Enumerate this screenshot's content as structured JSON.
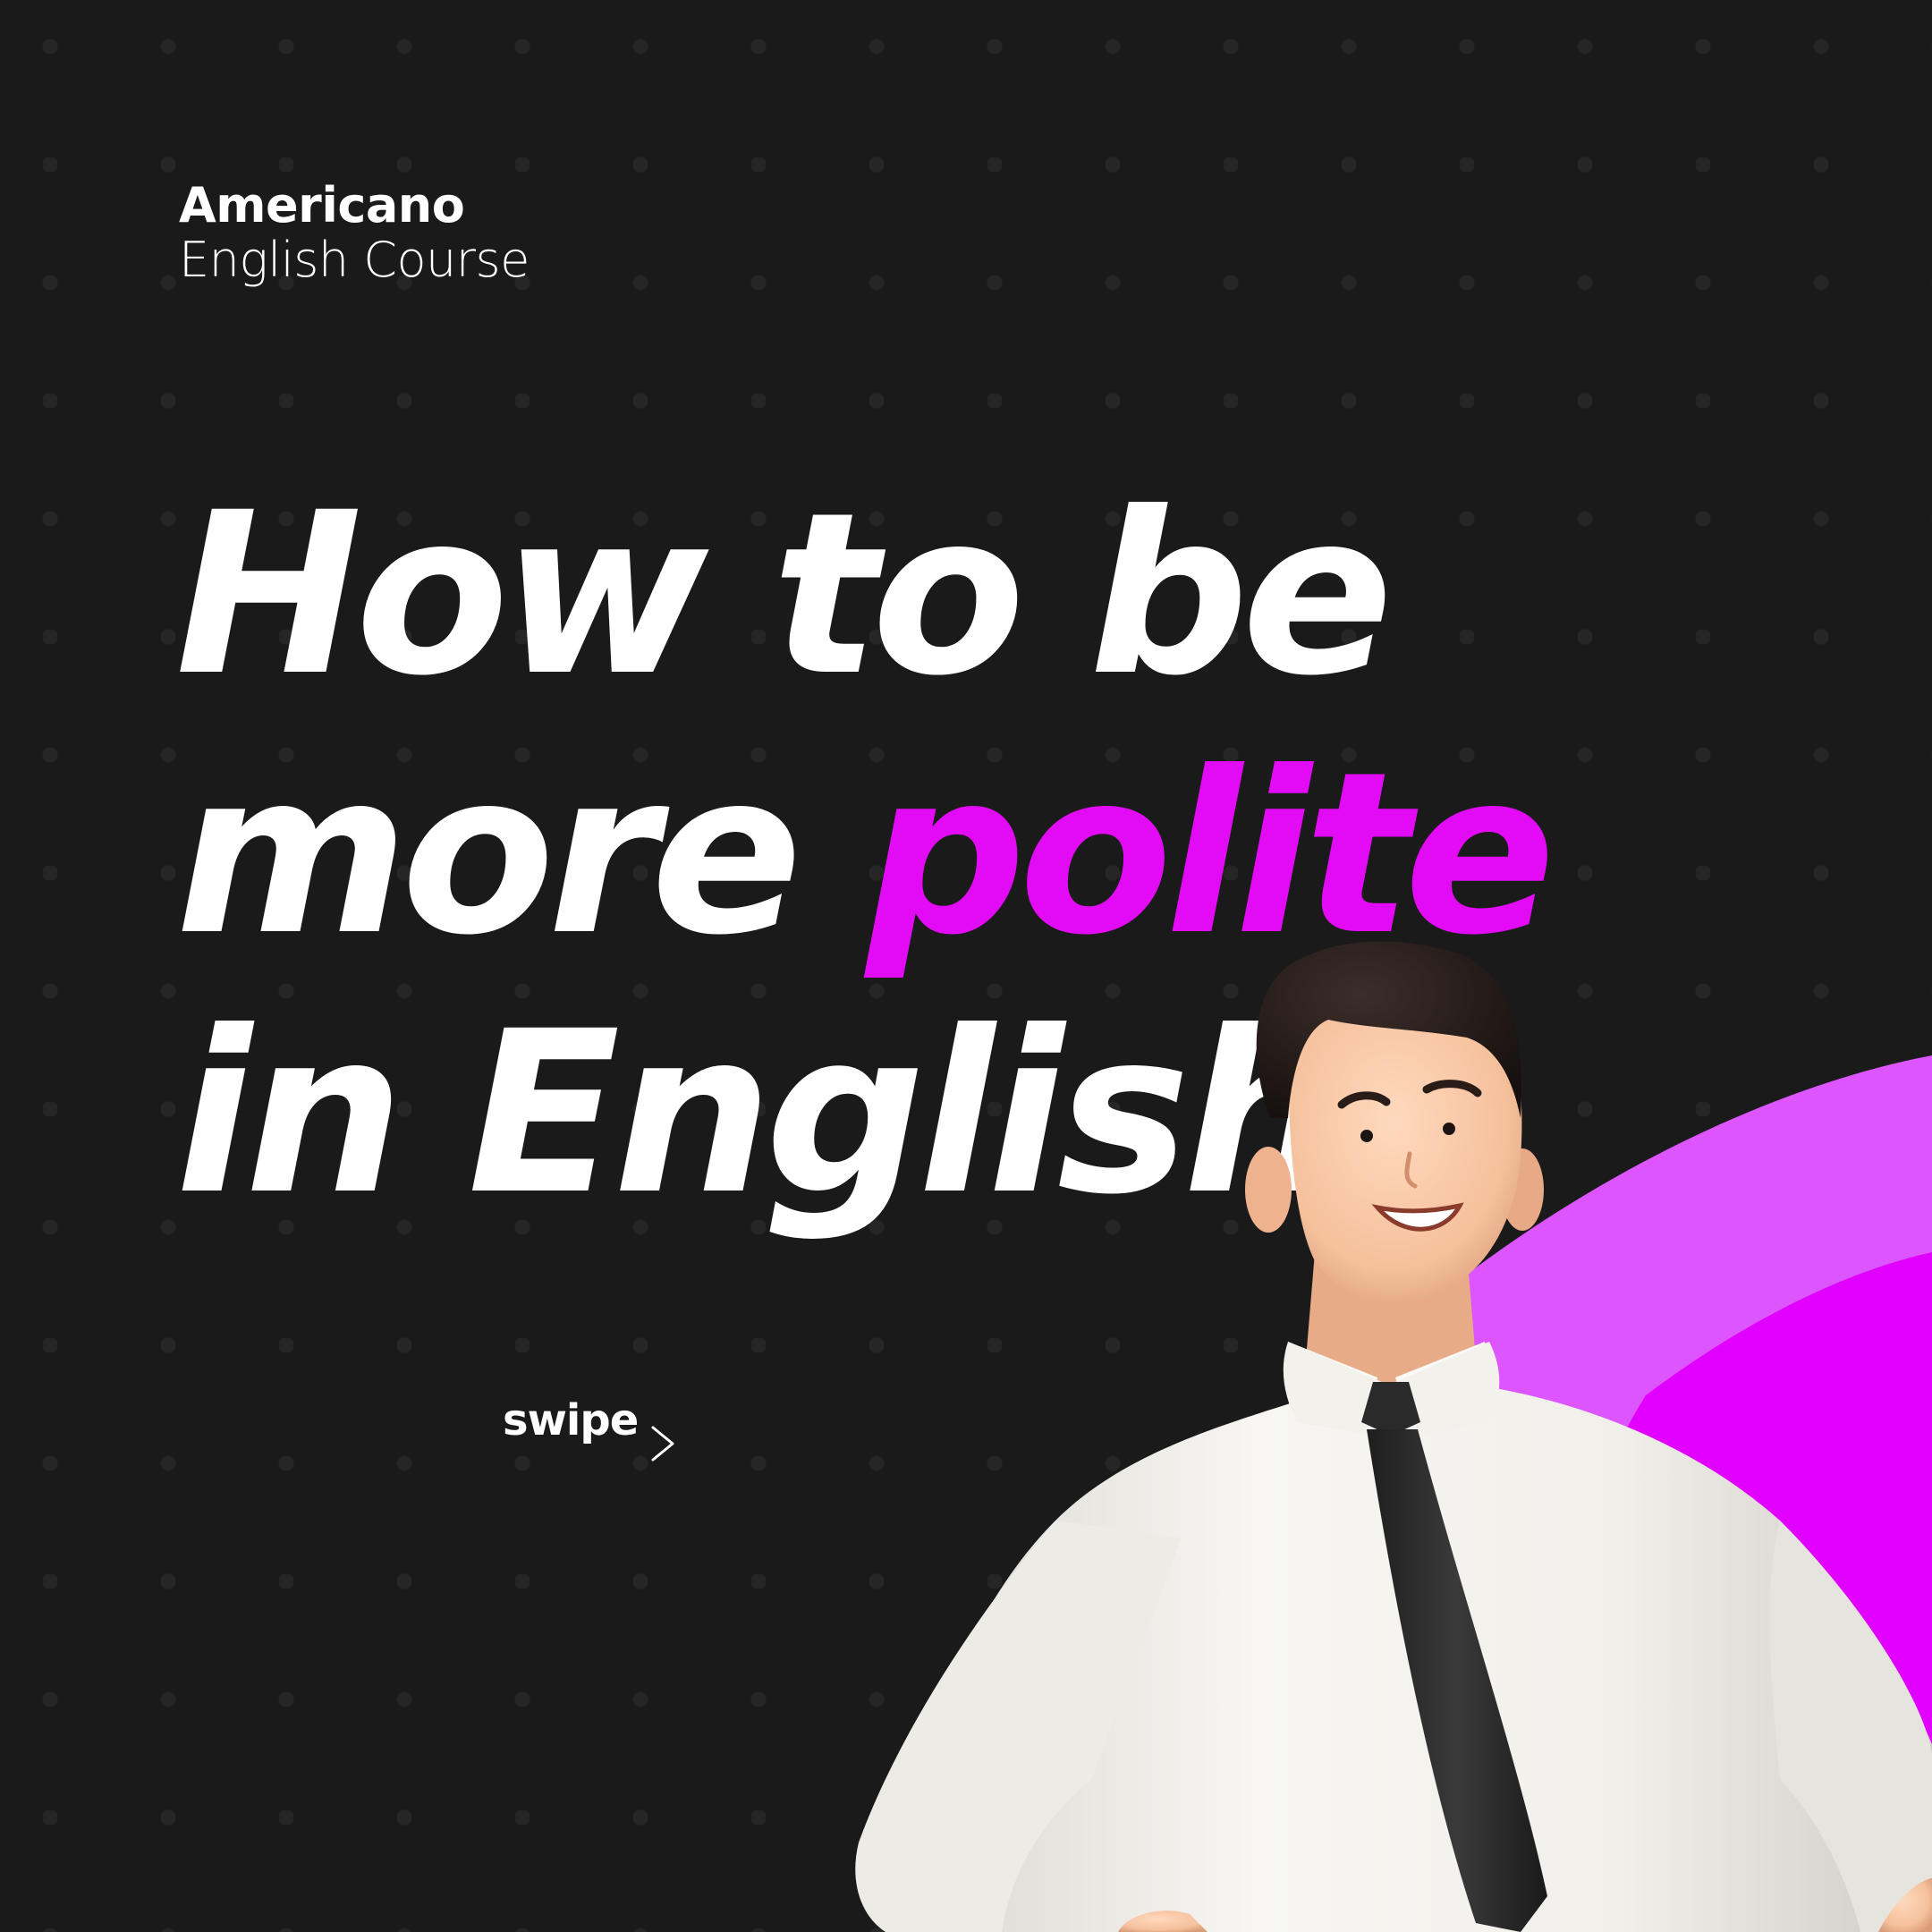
{
  "brand": {
    "name": "Americano",
    "subtitle": "English Course"
  },
  "headline": {
    "line1": "How to be",
    "line2_prefix": "more ",
    "line2_accent": "polite",
    "line3": "in English"
  },
  "swipe": {
    "label": "swipe",
    "icon": "arrow-right-icon"
  },
  "illustration": {
    "icon": "businessman-3d-character"
  },
  "colors": {
    "background": "#1a1a1a",
    "accent": "#e30bf5",
    "accent_light": "#dd55ff",
    "text": "#ffffff"
  }
}
